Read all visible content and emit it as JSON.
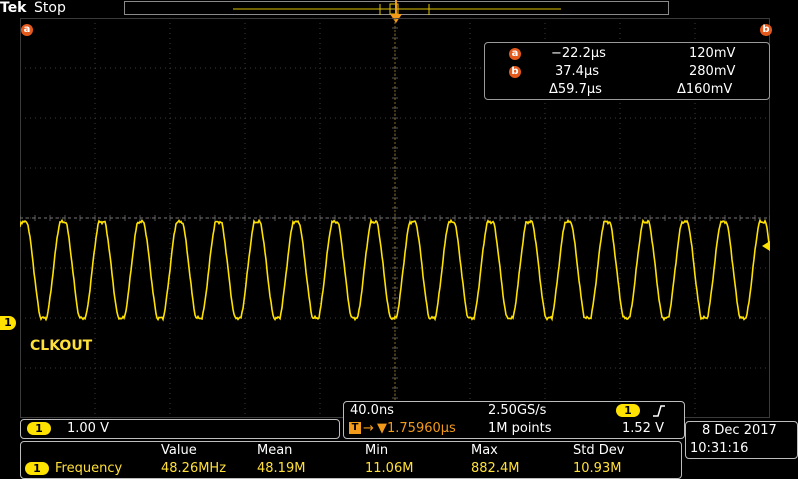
{
  "status": {
    "brand": "Tek",
    "run_state": "Stop"
  },
  "cursors": {
    "marker_a": "a",
    "marker_b": "b",
    "a_time": "−22.2µs",
    "a_volt": "120mV",
    "b_time": "37.4µs",
    "b_volt": "280mV",
    "delta_time": "Δ59.7µs",
    "delta_volt": "Δ160mV"
  },
  "channel": {
    "number": "1",
    "label": "CLKOUT",
    "scale": "1.00 V",
    "color": "#ffe200"
  },
  "horizontal": {
    "time_div": "40.0ns",
    "sample_rate": "2.50GS/s",
    "trigger_position": "▼1.75960µs",
    "record_length": "1M points",
    "trigger_channel": "1",
    "trigger_slope_icon": "rising-edge-icon",
    "trigger_level": "1.52 V"
  },
  "datetime": {
    "date": "8 Dec 2017",
    "time": "10:31:16"
  },
  "measurement": {
    "headers": [
      "Value",
      "Mean",
      "Min",
      "Max",
      "Std Dev"
    ],
    "name": "Frequency",
    "values": [
      "48.26MHz",
      "48.19M",
      "11.06M",
      "882.4M",
      "10.93M"
    ]
  },
  "colors": {
    "trace": "#ffe200",
    "cursor": "#e45a1c",
    "trigger": "#f29a1a"
  }
}
